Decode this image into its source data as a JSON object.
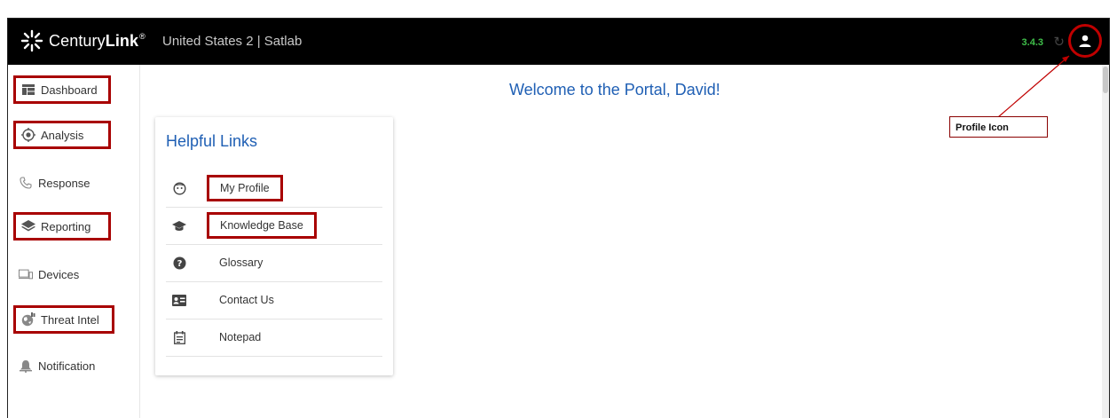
{
  "header": {
    "brand_light": "Century",
    "brand_bold": "Link",
    "brand_tm": "®",
    "subtitle": "United States 2 | Satlab",
    "version": "3.4.3"
  },
  "sidebar": {
    "items": [
      {
        "label": "Dashboard",
        "icon": "dashboard-icon",
        "highlighted": true
      },
      {
        "label": "Analysis",
        "icon": "target-icon",
        "highlighted": true
      },
      {
        "label": "Response",
        "icon": "phone-icon",
        "highlighted": false
      },
      {
        "label": "Reporting",
        "icon": "layers-icon",
        "highlighted": true
      },
      {
        "label": "Devices",
        "icon": "devices-icon",
        "highlighted": false
      },
      {
        "label": "Threat Intel",
        "icon": "globe-icon",
        "highlighted": true
      },
      {
        "label": "Notification",
        "icon": "bell-icon",
        "highlighted": false
      }
    ]
  },
  "main": {
    "welcome": "Welcome to the Portal, David!",
    "helpful_links": {
      "title": "Helpful Links",
      "items": [
        {
          "label": "My Profile",
          "icon": "smiley-icon",
          "highlighted": true
        },
        {
          "label": "Knowledge Base",
          "icon": "graduation-cap-icon",
          "highlighted": true
        },
        {
          "label": "Glossary",
          "icon": "help-circle-icon",
          "highlighted": false
        },
        {
          "label": "Contact Us",
          "icon": "contact-card-icon",
          "highlighted": false
        },
        {
          "label": "Notepad",
          "icon": "notepad-icon",
          "highlighted": false
        }
      ]
    }
  },
  "annotation": {
    "label": "Profile Icon",
    "color": "#c00000"
  },
  "colors": {
    "header_bg": "#000000",
    "version": "#3fbf4a",
    "link_blue": "#1f5fb4",
    "highlight": "#a80000"
  }
}
